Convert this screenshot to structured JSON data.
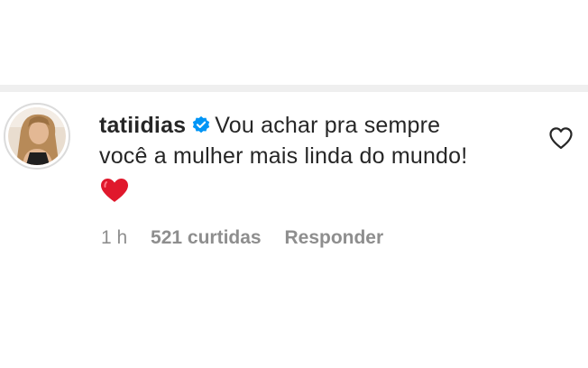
{
  "comment": {
    "username": "tatiidias",
    "text_line1": "Vou achar pra sempre",
    "text_line2": "você a mulher mais linda do mundo!",
    "emoji": "red-heart",
    "time": "1 h",
    "likes": "521 curtidas",
    "reply_label": "Responder"
  },
  "icons": {
    "verified": "verified-badge-icon",
    "like": "heart-outline-icon"
  },
  "colors": {
    "verified_blue": "#0095f6",
    "heart_red": "#e0182c",
    "text": "#262626",
    "meta": "#8e8e8e",
    "divider": "#efefef"
  }
}
